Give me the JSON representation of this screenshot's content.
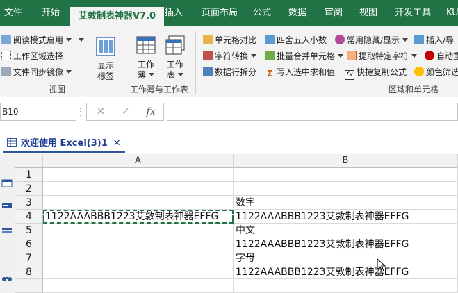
{
  "menu": {
    "tabs": [
      "文件",
      "开始",
      "艾敦制表神器V7.0",
      "插入",
      "页面布局",
      "公式",
      "数据",
      "审阅",
      "视图",
      "开发工具",
      "KU"
    ],
    "active_index": 2
  },
  "ribbon": {
    "view_group": {
      "items": [
        "阅读模式启用",
        "工作区域选择",
        "文件同步镜像"
      ],
      "show_tab_label": [
        "显示",
        "标签"
      ],
      "label": "视图"
    },
    "workbook_group": {
      "book_label": [
        "工作",
        "薄"
      ],
      "sheet_label": [
        "工作",
        "表"
      ],
      "label": "工作薄与工作表"
    },
    "region_group": {
      "col1": [
        "单元格对比",
        "字符转换",
        "数据行拆分"
      ],
      "col2": [
        "四舍五入小数",
        "批量合并单元格",
        "写入选中求和值"
      ],
      "col3": [
        "常用隐藏/显示",
        "提取特定字符",
        "快捷复制公式"
      ],
      "col4": [
        "插入/导",
        "自动重",
        "颜色筛选"
      ],
      "label": "区域和单元格"
    }
  },
  "formula_bar": {
    "name_box": "B10",
    "cancel": "✕",
    "enter": "✓",
    "fx": "fx",
    "value": ""
  },
  "workbook_tab": {
    "name": "欢迎使用 Excel(3)1",
    "close": "✕"
  },
  "grid": {
    "columns": [
      "A",
      "B"
    ],
    "rows": [
      {
        "num": "1",
        "a": "",
        "b": ""
      },
      {
        "num": "2",
        "a": "",
        "b": ""
      },
      {
        "num": "3",
        "a": "",
        "b": "数字"
      },
      {
        "num": "4",
        "a": "1122AAABBB1223艾敦制表神器EFFG",
        "b": "1122AAABBB1223艾敦制表神器EFFG"
      },
      {
        "num": "5",
        "a": "",
        "b": "中文"
      },
      {
        "num": "6",
        "a": "",
        "b": "1122AAABBB1223艾敦制表神器EFFG"
      },
      {
        "num": "7",
        "a": "",
        "b": "字母"
      },
      {
        "num": "8",
        "a": "",
        "b": "1122AAABBB1223艾敦制表神器EFFG"
      }
    ]
  },
  "colors": {
    "accent": "#217346",
    "tab_text": "#1e3c96"
  }
}
